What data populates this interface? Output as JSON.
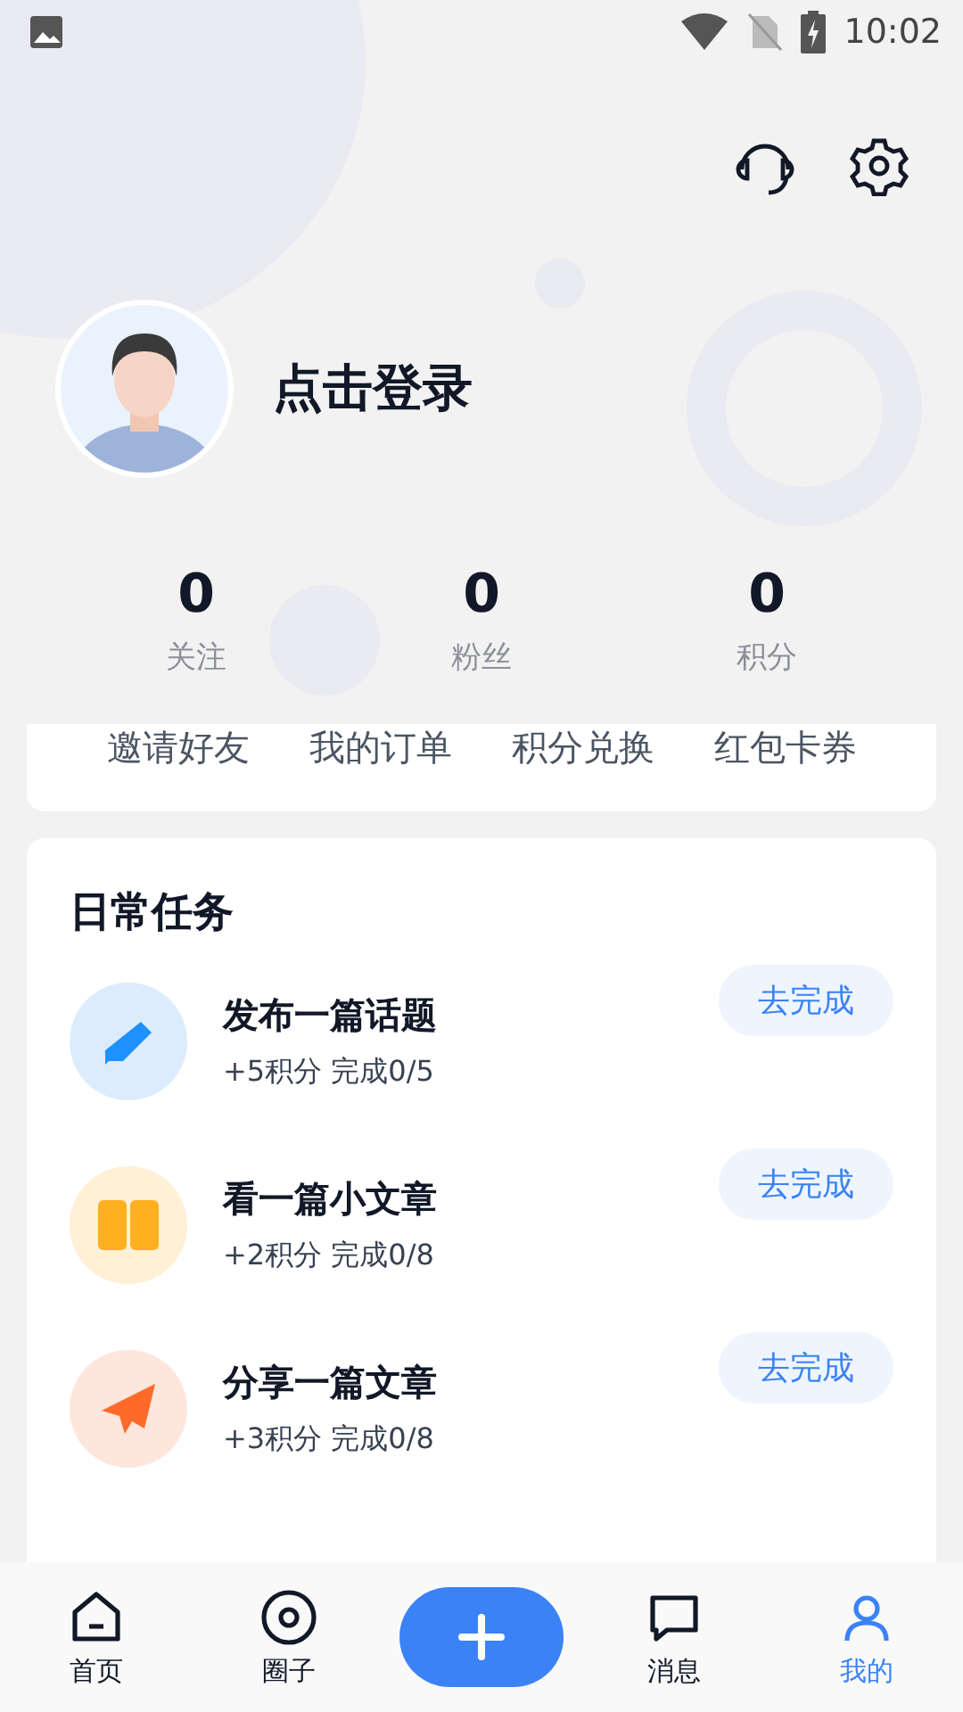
{
  "status_bar": {
    "time": "10:02"
  },
  "profile": {
    "login_text": "点击登录"
  },
  "stats": [
    {
      "value": "0",
      "label": "关注"
    },
    {
      "value": "0",
      "label": "粉丝"
    },
    {
      "value": "0",
      "label": "积分"
    }
  ],
  "shortcuts": [
    "邀请好友",
    "我的订单",
    "积分兑换",
    "红包卡券"
  ],
  "daily_tasks": {
    "title": "日常任务",
    "tasks": [
      {
        "kind": "pencil",
        "color": "#1e90ff",
        "title": "发布一篇话题",
        "reward": "+5积分 完成0/5",
        "button": "去完成"
      },
      {
        "kind": "book",
        "color": "#ffb020",
        "title": "看一篇小文章",
        "reward": "+2积分 完成0/8",
        "button": "去完成"
      },
      {
        "kind": "plane",
        "color": "#ff6a2a",
        "title": "分享一篇文章",
        "reward": "+3积分 完成0/8",
        "button": "去完成"
      }
    ]
  },
  "bottom_nav": [
    {
      "kind": "home",
      "label": "首页",
      "selected": false
    },
    {
      "kind": "circle",
      "label": "圈子",
      "selected": false
    },
    {
      "kind": "add"
    },
    {
      "kind": "message",
      "label": "消息",
      "selected": false
    },
    {
      "kind": "person",
      "label": "我的",
      "selected": true
    }
  ]
}
